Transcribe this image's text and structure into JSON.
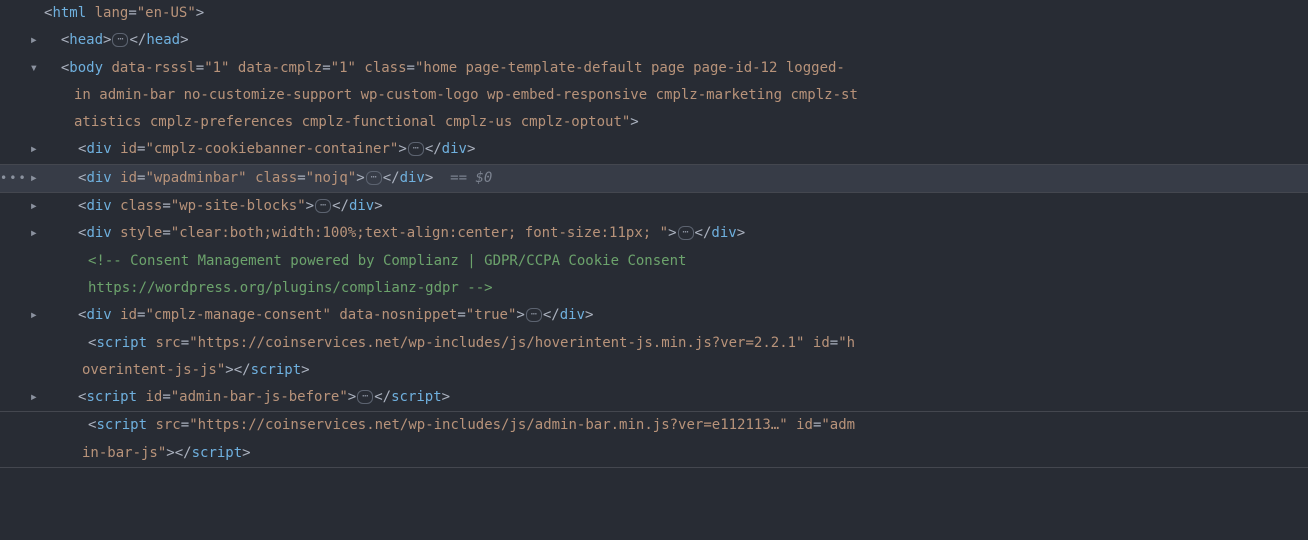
{
  "arrows": {
    "right": "▸",
    "down": "▾"
  },
  "ellipsis_dots": "•••",
  "badge": "⋯",
  "marker_eq": "== $0",
  "line1": {
    "tag": "html",
    "attr": "lang",
    "val": "\"en-US\""
  },
  "line2": {
    "tag_open": "head",
    "tag_close": "head"
  },
  "line3": {
    "tag": "body",
    "a1": "data-rsssl",
    "v1": "\"1\"",
    "a2": "data-cmplz",
    "v2": "\"1\"",
    "a3": "class",
    "v3a": "\"home page-template-default page page-id-12 logged-",
    "v3b": "in admin-bar no-customize-support wp-custom-logo wp-embed-responsive cmplz-marketing cmplz-st",
    "v3c": "atistics cmplz-preferences cmplz-functional cmplz-us cmplz-optout\""
  },
  "line4": {
    "tag": "div",
    "a1": "id",
    "v1": "\"cmplz-cookiebanner-container\"",
    "close": "div"
  },
  "line5": {
    "tag": "div",
    "a1": "id",
    "v1": "\"wpadminbar\"",
    "a2": "class",
    "v2": "\"nojq\"",
    "close": "div"
  },
  "line6": {
    "tag": "div",
    "a1": "class",
    "v1": "\"wp-site-blocks\"",
    "close": "div"
  },
  "line7": {
    "tag": "div",
    "a1": "style",
    "v1": "\"clear:both;width:100%;text-align:center; font-size:11px; \"",
    "close": "div"
  },
  "line8a": "<!-- Consent Management powered by Complianz | GDPR/CCPA Cookie Consent ",
  "line8b": "https://wordpress.org/plugins/complianz-gdpr -->",
  "line9": {
    "tag": "div",
    "a1": "id",
    "v1": "\"cmplz-manage-consent\"",
    "a2": "data-nosnippet",
    "v2": "\"true\"",
    "close": "div"
  },
  "line10": {
    "tag": "script",
    "a1": "src",
    "v1": "\"https://coinservices.net/wp-includes/js/hoverintent-js.min.js?ver=2.2.1\"",
    "a2": "id",
    "v2a": "\"h",
    "v2b": "overintent-js-js\"",
    "close": "script"
  },
  "line11": {
    "tag": "script",
    "a1": "id",
    "v1": "\"admin-bar-js-before\"",
    "close": "script"
  },
  "line12": {
    "tag": "script",
    "a1": "src",
    "v1": "\"https://coinservices.net/wp-includes/js/admin-bar.min.js?ver=e112113…\"",
    "a2": "id",
    "v2a": "\"adm",
    "v2b": "in-bar-js\"",
    "close": "script"
  }
}
